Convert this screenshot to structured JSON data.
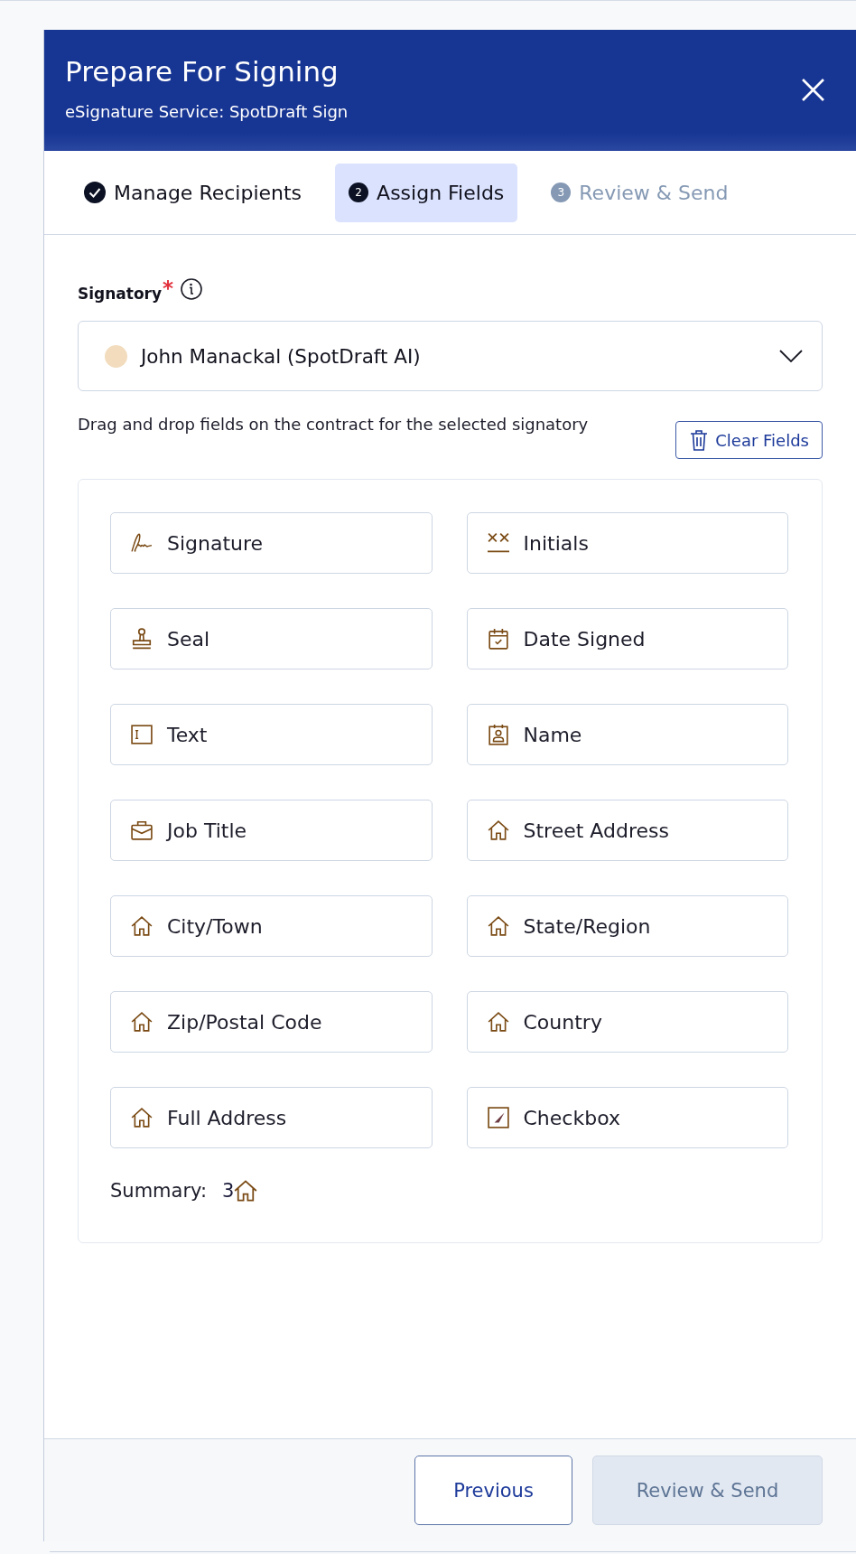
{
  "dialog": {
    "title": "Prepare For Signing",
    "subtitle": "eSignature Service: SpotDraft Sign"
  },
  "steps": [
    {
      "label": "Manage Recipients",
      "kind": "done",
      "selected": false
    },
    {
      "label": "Assign Fields",
      "kind": "current",
      "number": "2",
      "selected": true
    },
    {
      "label": "Review & Send",
      "kind": "upcoming",
      "number": "3",
      "selected": false
    }
  ],
  "signatory": {
    "label": "Signatory",
    "required_mark": "*",
    "value": "John Manackal (SpotDraft AI)",
    "color": "#f2dcbd"
  },
  "instructions": "Drag and drop fields on the contract for the selected signatory",
  "clear_button": "Clear Fields",
  "fields": [
    {
      "label": "Signature",
      "kind": "signature"
    },
    {
      "label": "Initials",
      "kind": "initials"
    },
    {
      "label": "Seal",
      "kind": "seal"
    },
    {
      "label": "Date Signed",
      "kind": "date"
    },
    {
      "label": "Text",
      "kind": "text"
    },
    {
      "label": "Name",
      "kind": "name"
    },
    {
      "label": "Job Title",
      "kind": "job"
    },
    {
      "label": "Street Address",
      "kind": "address"
    },
    {
      "label": "City/Town",
      "kind": "address"
    },
    {
      "label": "State/Region",
      "kind": "address"
    },
    {
      "label": "Zip/Postal Code",
      "kind": "address"
    },
    {
      "label": "Country",
      "kind": "address"
    },
    {
      "label": "Full Address",
      "kind": "address"
    },
    {
      "label": "Checkbox",
      "kind": "checkbox"
    }
  ],
  "summary": {
    "label": "Summary:",
    "count": "3",
    "kind": "address"
  },
  "footer": {
    "buttons": [
      {
        "label": "Previous",
        "kind": "secondary",
        "disabled": false
      },
      {
        "label": "Review & Send",
        "kind": "primary",
        "disabled": true
      }
    ]
  }
}
